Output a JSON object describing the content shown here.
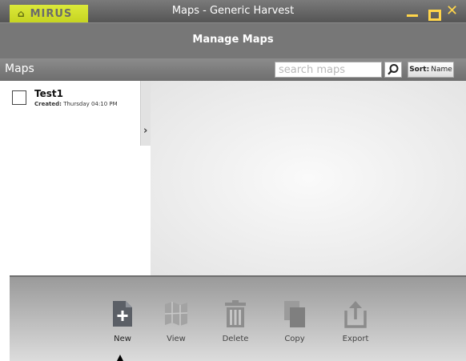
{
  "window": {
    "brand": "MIRUS",
    "title": "Maps - Generic Harvest"
  },
  "header": {
    "title": "Manage Maps"
  },
  "toolbar": {
    "section_title": "Maps",
    "search_placeholder": "search maps",
    "sort_label_bold": "Sort:",
    "sort_label_value": "Name"
  },
  "maps": [
    {
      "name": "Test1",
      "created_label": "Created:",
      "created_value": "Thursday 04:10 PM"
    }
  ],
  "actions": [
    {
      "label": "New",
      "icon": "new-document-icon",
      "enabled": true
    },
    {
      "label": "View",
      "icon": "map-icon",
      "enabled": false
    },
    {
      "label": "Delete",
      "icon": "trash-icon",
      "enabled": false
    },
    {
      "label": "Copy",
      "icon": "copy-icon",
      "enabled": false
    },
    {
      "label": "Export",
      "icon": "export-icon",
      "enabled": false
    }
  ],
  "colors": {
    "brand_accent": "#d4e22c",
    "close_button": "#ffb300",
    "icon_enabled": "#5b5f66",
    "icon_disabled": "#9a9a9a"
  }
}
